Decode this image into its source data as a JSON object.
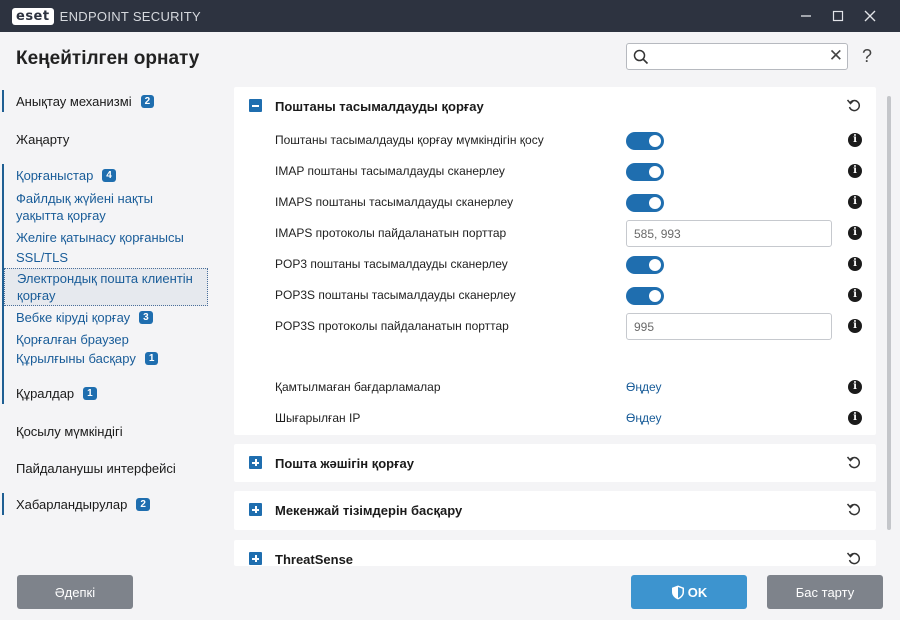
{
  "window": {
    "logo": "eset",
    "product": "ENDPOINT SECURITY",
    "controls": [
      "minimize-icon",
      "maximize-icon",
      "close-icon"
    ]
  },
  "header": {
    "title": "Кеңейтілген орнату",
    "search_value": "",
    "help": "?"
  },
  "sidebar": {
    "items": [
      {
        "label": "Анықтау механизмі",
        "badge": "2"
      },
      {
        "label": "Жаңарту"
      },
      {
        "label": "Қорғаныстар",
        "badge": "4"
      },
      {
        "label": "Файлдық жүйені нақты уақытта қорғау"
      },
      {
        "label": "Желіге қатынасу қорғанысы"
      },
      {
        "label": "SSL/TLS"
      },
      {
        "label": "Электрондық пошта клиентін қорғау"
      },
      {
        "label": "Вебке кіруді қорғау",
        "badge": "3"
      },
      {
        "label": "Қорғалған браузер"
      },
      {
        "label": "Құрылғыны басқару",
        "badge": "1"
      },
      {
        "label": "Құралдар",
        "badge": "1"
      },
      {
        "label": "Қосылу мүмкіндігі"
      },
      {
        "label": "Пайдаланушы интерфейсі"
      },
      {
        "label": "Хабарландырулар",
        "badge": "2"
      }
    ]
  },
  "main": {
    "sections": [
      {
        "title": "Поштаны тасымалдауды қорғау",
        "expanded": true,
        "rows": [
          {
            "label": "Поштаны тасымалдауды қорғау мүмкіндігін қосу",
            "type": "toggle",
            "on": true
          },
          {
            "label": "IMAP поштаны тасымалдауды сканерлеу",
            "type": "toggle",
            "on": true
          },
          {
            "label": "IMAPS поштаны тасымалдауды сканерлеу",
            "type": "toggle",
            "on": true
          },
          {
            "label": "IMAPS протоколы пайдаланатын порттар",
            "type": "input",
            "value": "585, 993"
          },
          {
            "label": "POP3 поштаны тасымалдауды сканерлеу",
            "type": "toggle",
            "on": true
          },
          {
            "label": "POP3S поштаны тасымалдауды сканерлеу",
            "type": "toggle",
            "on": true
          },
          {
            "label": "POP3S протоколы пайдаланатын порттар",
            "type": "input",
            "value": "995"
          },
          {
            "label": "Қамтылмаған бағдарламалар",
            "type": "link",
            "value": "Өңдеу"
          },
          {
            "label": "Шығарылған IP",
            "type": "link",
            "value": "Өңдеу"
          }
        ]
      },
      {
        "title": "Пошта жәшігін қорғау",
        "expanded": false
      },
      {
        "title": "Мекенжай тізімдерін басқару",
        "expanded": false
      },
      {
        "title": "ThreatSense",
        "expanded": false
      }
    ]
  },
  "footer": {
    "default_label": "Әдепкі",
    "ok_label": "OK",
    "cancel_label": "Бас тарту"
  },
  "colors": {
    "titlebar": "#2d3340",
    "accent": "#1f6eaf",
    "link": "#1a5d99",
    "ok_button": "#3d94cf",
    "secondary_button": "#7e838b"
  }
}
